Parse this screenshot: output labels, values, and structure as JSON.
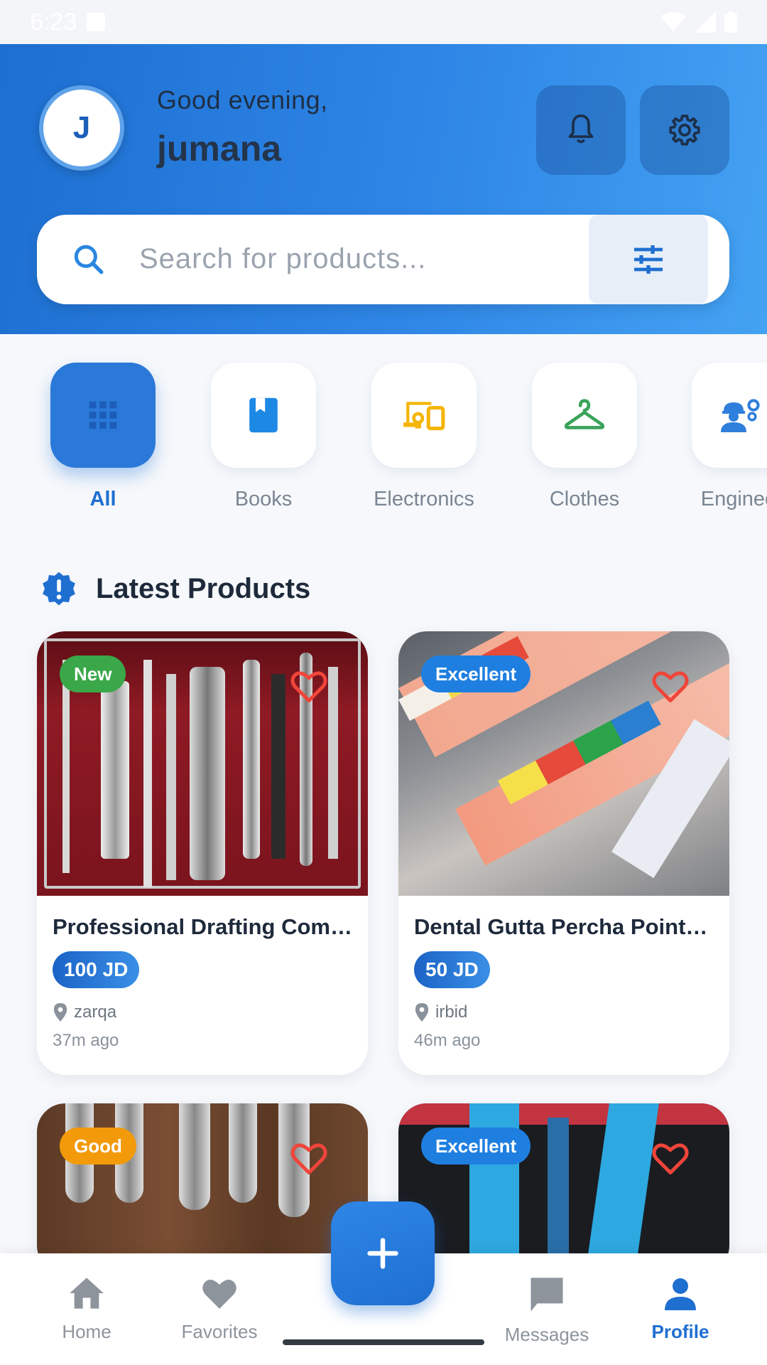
{
  "status_bar": {
    "time": "6:23"
  },
  "header": {
    "avatar_initial": "J",
    "greeting": "Good evening,",
    "username": "jumana",
    "icons": {
      "notifications": "bell-icon",
      "settings": "gear-icon"
    }
  },
  "search": {
    "placeholder": "Search for products...",
    "icon": "search-icon",
    "filter_icon": "sliders-icon"
  },
  "categories": [
    {
      "label": "All",
      "icon": "grid-icon",
      "active": true
    },
    {
      "label": "Books",
      "icon": "book-icon",
      "color": "#1e88e5"
    },
    {
      "label": "Electronics",
      "icon": "devices-icon",
      "color": "#f5b400"
    },
    {
      "label": "Clothes",
      "icon": "hanger-icon",
      "color": "#3aa35a"
    },
    {
      "label": "Engineeri",
      "icon": "engineer-icon",
      "color": "#2f7fdc"
    }
  ],
  "section": {
    "title": "Latest Products",
    "icon": "new-release-icon"
  },
  "products": [
    {
      "badge": "New",
      "badge_color": "#3aa749",
      "title": "Professional Drafting Com…",
      "price": "100 JD",
      "location": "zarqa",
      "time": "37m ago"
    },
    {
      "badge": "Excellent",
      "badge_color": "#1f7fe0",
      "title": "Dental Gutta Percha Points…",
      "price": "50 JD",
      "location": "irbid",
      "time": "46m ago"
    },
    {
      "badge": "Good",
      "badge_color": "#f39a0a"
    },
    {
      "badge": "Excellent",
      "badge_color": "#1f7fe0"
    }
  ],
  "bottom_nav": [
    {
      "label": "Home",
      "icon": "home-icon"
    },
    {
      "label": "Favorites",
      "icon": "heart-icon"
    },
    {
      "label": "Messages",
      "icon": "chat-icon"
    },
    {
      "label": "Profile",
      "icon": "person-icon",
      "active": true
    }
  ],
  "fab": {
    "icon": "plus-icon"
  },
  "colors": {
    "primary": "#1f6fd1",
    "background": "#f6f8fb"
  }
}
